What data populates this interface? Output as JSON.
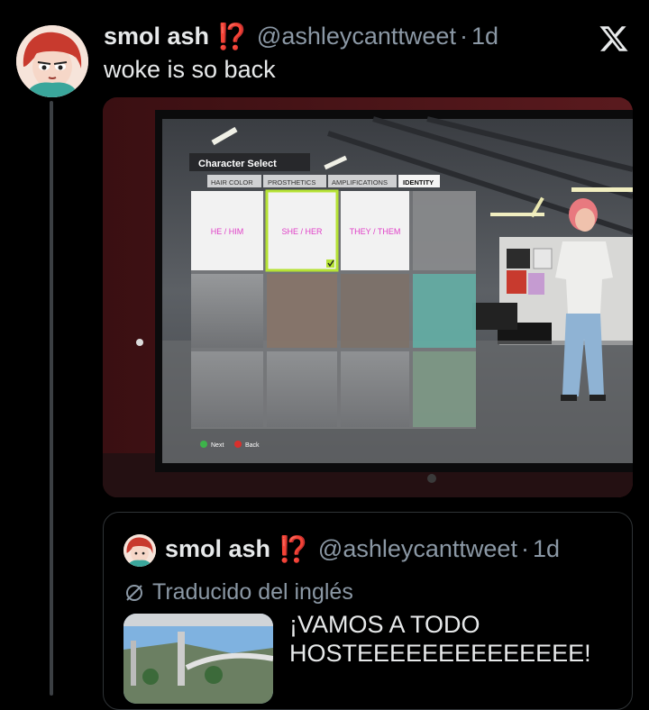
{
  "tweet": {
    "display_name": "smol ash",
    "emoji": "⁉️",
    "handle": "@ashleycanttweet",
    "separator": "·",
    "time": "1d",
    "text": "woke is so back"
  },
  "game": {
    "title": "Character Select",
    "tabs": [
      "HAIR COLOR",
      "PROSTHETICS",
      "AMPLIFICATIONS",
      "IDENTITY"
    ],
    "options": [
      "HE / HIM",
      "SHE / HER",
      "THEY / THEM"
    ],
    "selected_option": "SHE / HER",
    "next_label": "Next",
    "back_label": "Back"
  },
  "quote": {
    "display_name": "smol ash",
    "emoji": "⁉️",
    "handle": "@ashleycanttweet",
    "separator": "·",
    "time": "1d",
    "translated_label": "Traducido del inglés",
    "text_line1": "¡VAMOS A TODO",
    "text_line2": "HOSTEEEEEEEEEEEEEE!"
  },
  "colors": {
    "background": "#000000",
    "text_primary": "#e7e9ea",
    "text_secondary": "#8b98a5",
    "emoji_red": "#f4212e",
    "identity_option_pink": "#e040c8",
    "selection_green": "#b5e234"
  }
}
